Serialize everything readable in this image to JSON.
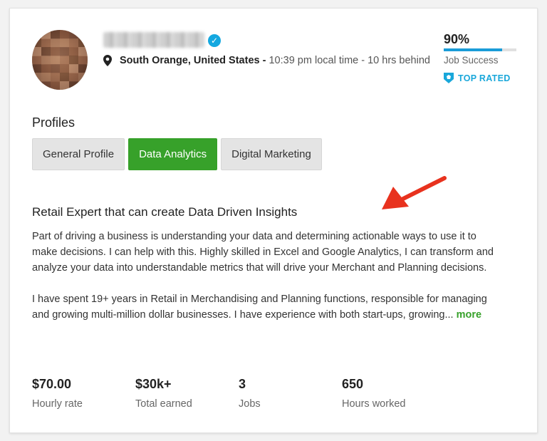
{
  "profile": {
    "location_city": "South Orange, United States",
    "location_sep": " - ",
    "location_detail": "10:39 pm local time - 10 hrs behind"
  },
  "job_success": {
    "percent_label": "90%",
    "fill_fraction": 0.8,
    "label": "Job Success"
  },
  "top_rated": {
    "label": "TOP RATED",
    "color": "#19a7da"
  },
  "profiles": {
    "title": "Profiles",
    "tabs": [
      {
        "label": "General Profile",
        "active": false
      },
      {
        "label": "Data Analytics",
        "active": true
      },
      {
        "label": "Digital Marketing",
        "active": false
      }
    ]
  },
  "overview": {
    "headline": "Retail Expert that can create Data Driven Insights",
    "paragraph1": "Part of driving a business is understanding your data and determining actionable ways to use it to make decisions. I can help with this. Highly skilled in Excel and Google Analytics, I can transform and analyze your data into understandable metrics that will drive your Merchant and Planning decisions.",
    "paragraph2": "I have spent 19+ years in Retail in Merchandising and Planning functions, responsible for managing and growing multi-million dollar businesses. I have experience with both start-ups, growing...",
    "more_label": "more"
  },
  "stats": [
    {
      "value": "$70.00",
      "label": "Hourly rate"
    },
    {
      "value": "$30k+",
      "label": "Total earned"
    },
    {
      "value": "3",
      "label": "Jobs"
    },
    {
      "value": "650",
      "label": "Hours worked"
    }
  ],
  "colors": {
    "accent_green": "#37a12a",
    "brand_blue": "#1a9cd8",
    "arrow_red": "#e8321e"
  },
  "icons": {
    "verified": "check-badge-icon",
    "location": "map-pin-icon",
    "top_rated": "shield-badge-icon"
  }
}
